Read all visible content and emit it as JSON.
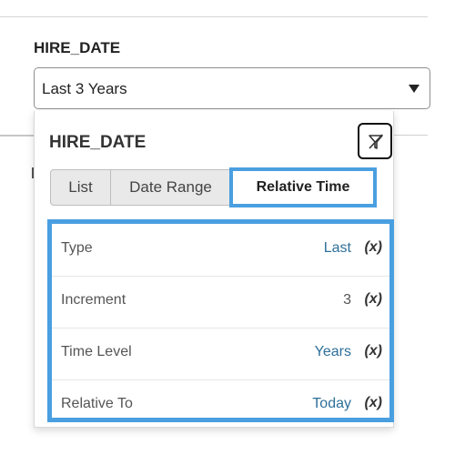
{
  "field": {
    "label": "HIRE_DATE",
    "selected_value": "Last 3 Years"
  },
  "popup": {
    "title": "HIRE_DATE",
    "clear_filter_icon": "filter-clear-icon",
    "tabs": [
      {
        "label": "List",
        "selected": false
      },
      {
        "label": "Date Range",
        "selected": false
      },
      {
        "label": "Relative Time",
        "selected": true
      }
    ],
    "properties": [
      {
        "label": "Type",
        "value": "Last",
        "expr": "(x)"
      },
      {
        "label": "Increment",
        "value": "3",
        "expr": "(x)"
      },
      {
        "label": "Time Level",
        "value": "Years",
        "expr": "(x)"
      },
      {
        "label": "Relative To",
        "value": "Today",
        "expr": "(x)"
      }
    ]
  },
  "colors": {
    "highlight": "#4a9fe0",
    "value_link": "#2e6f99"
  }
}
